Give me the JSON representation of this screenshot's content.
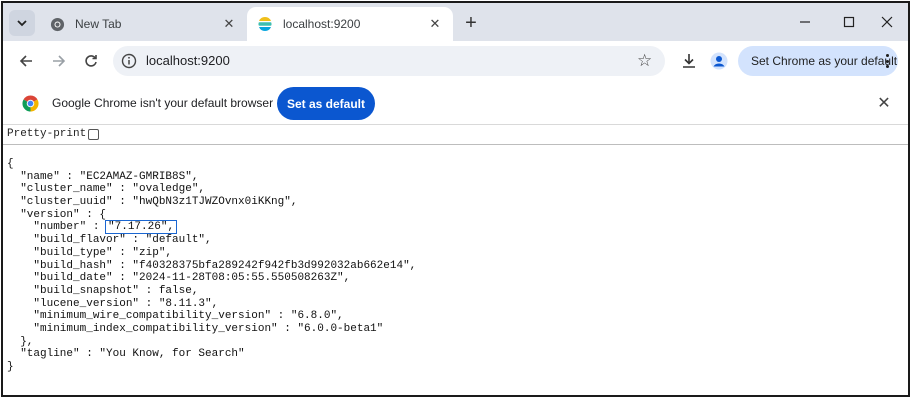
{
  "browser": {
    "tabs": [
      {
        "title": "New Tab",
        "icon": "chrome-icon",
        "active": false
      },
      {
        "title": "localhost:9200",
        "icon": "elasticsearch-icon",
        "active": true
      }
    ],
    "url": "localhost:9200",
    "default_button_label": "Set Chrome as your default"
  },
  "infobar": {
    "message": "Google Chrome isn't your default browser",
    "button_label": "Set as default"
  },
  "page": {
    "pretty_print_label": "Pretty-print",
    "json_lines": [
      "{",
      "  \"name\" : \"EC2AMAZ-GMRIB8S\",",
      "  \"cluster_name\" : \"ovaledge\",",
      "  \"cluster_uuid\" : \"hwQbN3z1TJWZOvnx0iKKng\",",
      "  \"version\" : {",
      "    \"number\" : ",
      "    \"build_flavor\" : \"default\",",
      "    \"build_type\" : \"zip\",",
      "    \"build_hash\" : \"f40328375bfa289242f942fb3d992032ab662e14\",",
      "    \"build_date\" : \"2024-11-28T08:05:55.550508263Z\",",
      "    \"build_snapshot\" : false,",
      "    \"lucene_version\" : \"8.11.3\",",
      "    \"minimum_wire_compatibility_version\" : \"6.8.0\",",
      "    \"minimum_index_compatibility_version\" : \"6.0.0-beta1\"",
      "  },",
      "  \"tagline\" : \"You Know, for Search\"",
      "}"
    ],
    "highlighted_value": "\"7.17.26\","
  },
  "colors": {
    "tabstrip": "#dfe3eb",
    "accent": "#0b57d0",
    "highlight_box": "#1a66d1"
  }
}
